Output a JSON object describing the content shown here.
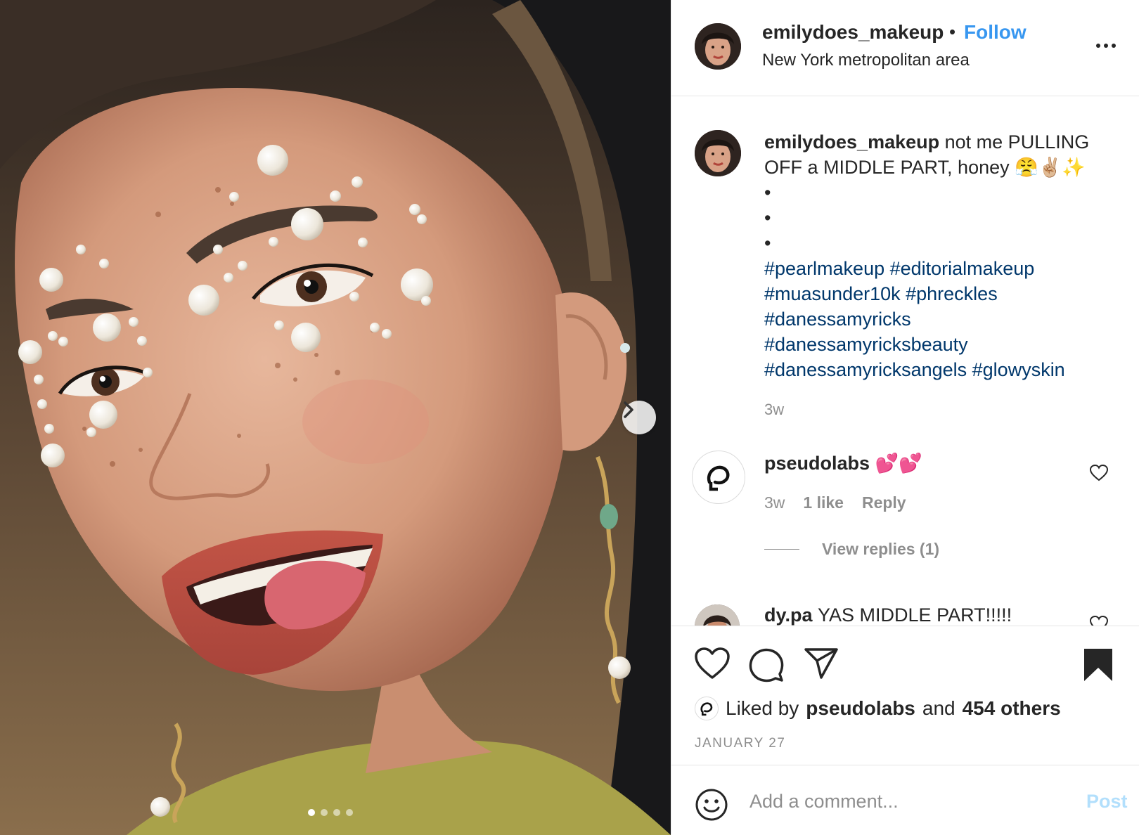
{
  "post": {
    "username": "emilydoes_makeup",
    "separator": "•",
    "follow_label": "Follow",
    "location": "New York metropolitan area",
    "more_icon": "more-horizontal-icon"
  },
  "caption": {
    "username": "emilydoes_makeup",
    "text": "not me PULLING OFF a MIDDLE PART, honey 😤✌🏼✨",
    "bullets": [
      "•",
      "•",
      "•"
    ],
    "hashtags": "#pearlmakeup #editorialmakeup #muasunder10k #phreckles #danessamyricks #danessamyricksbeauty #danessamyricksangels #glowyskin",
    "time": "3w"
  },
  "comments": [
    {
      "username": "pseudolabs",
      "text": "💕💕",
      "time": "3w",
      "likes": "1 like",
      "reply_label": "Reply",
      "view_replies": "View replies (1)"
    },
    {
      "username": "dy.pa",
      "text": "YAS MIDDLE PART!!!!!"
    }
  ],
  "actions": {
    "liked_by_prefix": "Liked by",
    "liked_by_user": "pseudolabs",
    "liked_by_and": "and",
    "liked_by_others": "454 others",
    "date": "JANUARY 27"
  },
  "add_comment": {
    "placeholder": "Add a comment...",
    "post_label": "Post"
  },
  "carousel": {
    "total": 4,
    "active": 1
  },
  "colors": {
    "accent": "#3897f0",
    "hashtag": "#00376b",
    "muted": "#8e8e8e",
    "post_disabled": "#b2dffc"
  }
}
